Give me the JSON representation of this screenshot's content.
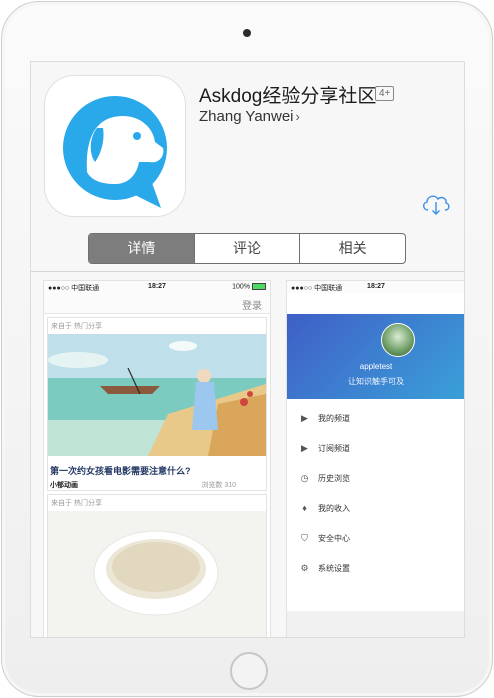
{
  "app": {
    "name": "Askdog经验分享社区",
    "age_rating": "4+",
    "developer": "Zhang Yanwei",
    "developer_chevron": "›",
    "brand_color": "#29a8ea"
  },
  "tabs": [
    "详情",
    "评论",
    "相关"
  ],
  "screenshot1": {
    "carrier": "●●●○○ 中国联通",
    "time": "18:27",
    "battery": "100%",
    "login": "登录",
    "cards": [
      {
        "source": "来自于 热门分享",
        "title": "第一次约女孩看电影需要注意什么?",
        "author": "小郁动画",
        "views": "浏览数 310"
      },
      {
        "source": "来自于 热门分享"
      }
    ]
  },
  "screenshot2": {
    "carrier": "●●●○○ 中国联通",
    "time": "18:27",
    "username": "appletest",
    "tagline": "让知识触手可及",
    "menu": [
      {
        "icon": "play-icon",
        "glyph": "▶",
        "label": "我的频道"
      },
      {
        "icon": "subscribe-icon",
        "glyph": "▶",
        "label": "订阅频道"
      },
      {
        "icon": "clock-icon",
        "glyph": "◷",
        "label": "历史浏览"
      },
      {
        "icon": "money-bag-icon",
        "glyph": "♦",
        "label": "我的收入"
      },
      {
        "icon": "shield-icon",
        "glyph": "⛉",
        "label": "安全中心"
      },
      {
        "icon": "gear-icon",
        "glyph": "⚙",
        "label": "系统设置"
      }
    ]
  }
}
